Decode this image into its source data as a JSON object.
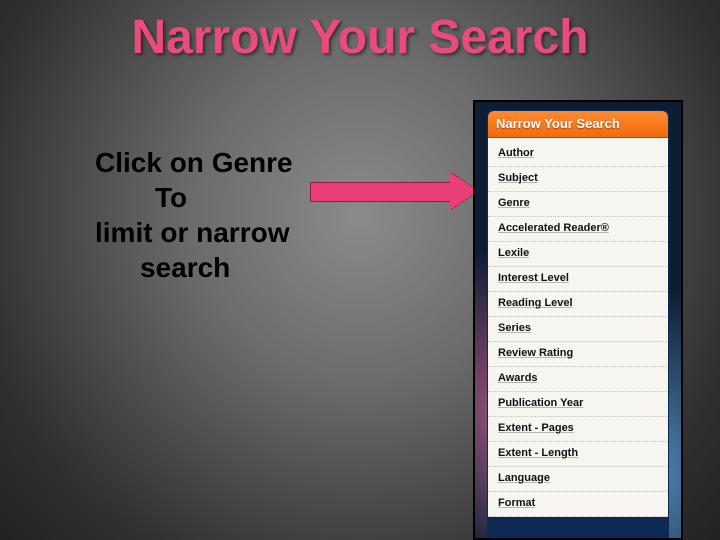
{
  "title": "Narrow Your Search",
  "body": {
    "line1": "Click on Genre",
    "line2": "To",
    "line3": "limit or narrow",
    "line4": "search"
  },
  "arrow": {
    "color": "#ec3f77"
  },
  "panel": {
    "header": "Narrow Your Search",
    "items": [
      "Author",
      "Subject",
      "Genre",
      "Accelerated Reader®",
      "Lexile",
      "Interest Level",
      "Reading Level",
      "Series",
      "Review Rating",
      "Awards",
      "Publication Year",
      "Extent - Pages",
      "Extent - Length",
      "Language",
      "Format"
    ]
  }
}
